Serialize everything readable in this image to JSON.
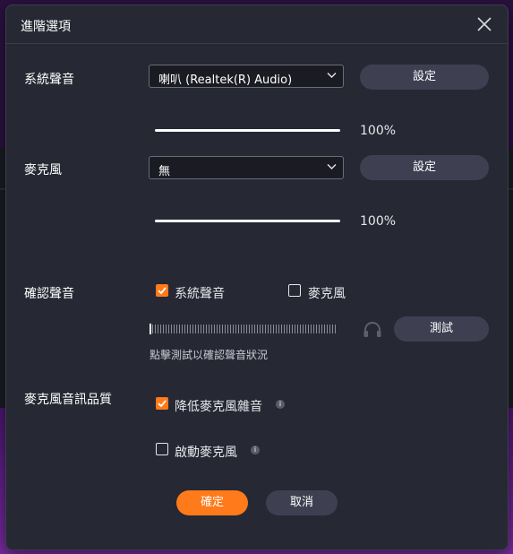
{
  "dialog": {
    "title": "進階選項",
    "close_icon": "close-icon"
  },
  "system_audio": {
    "label": "系統聲音",
    "device_selected": "喇叭 (Realtek(R) Audio)",
    "settings_label": "設定",
    "volume_text": "100%",
    "volume_value": 100
  },
  "microphone": {
    "label": "麥克風",
    "device_selected": "無",
    "settings_label": "設定",
    "volume_text": "100%",
    "volume_value": 100
  },
  "confirm_audio": {
    "label": "確認聲音",
    "options": [
      {
        "label": "系統聲音",
        "checked": true
      },
      {
        "label": "麥克風",
        "checked": false
      }
    ],
    "test_label": "測試",
    "hint": "點擊測試以確認聲音狀況",
    "headphone_icon": "headphones-icon"
  },
  "mic_quality": {
    "label": "麥克風音訊品質",
    "options": [
      {
        "label": "降低麥克風雜音",
        "checked": true
      },
      {
        "label": "啟動麥克風",
        "checked": false
      }
    ],
    "info_glyph": "i"
  },
  "footer": {
    "ok_label": "確定",
    "cancel_label": "取消"
  },
  "colors": {
    "accent": "#ff7a1a",
    "dialog_bg": "#262833",
    "button_grey": "#3e4052"
  }
}
